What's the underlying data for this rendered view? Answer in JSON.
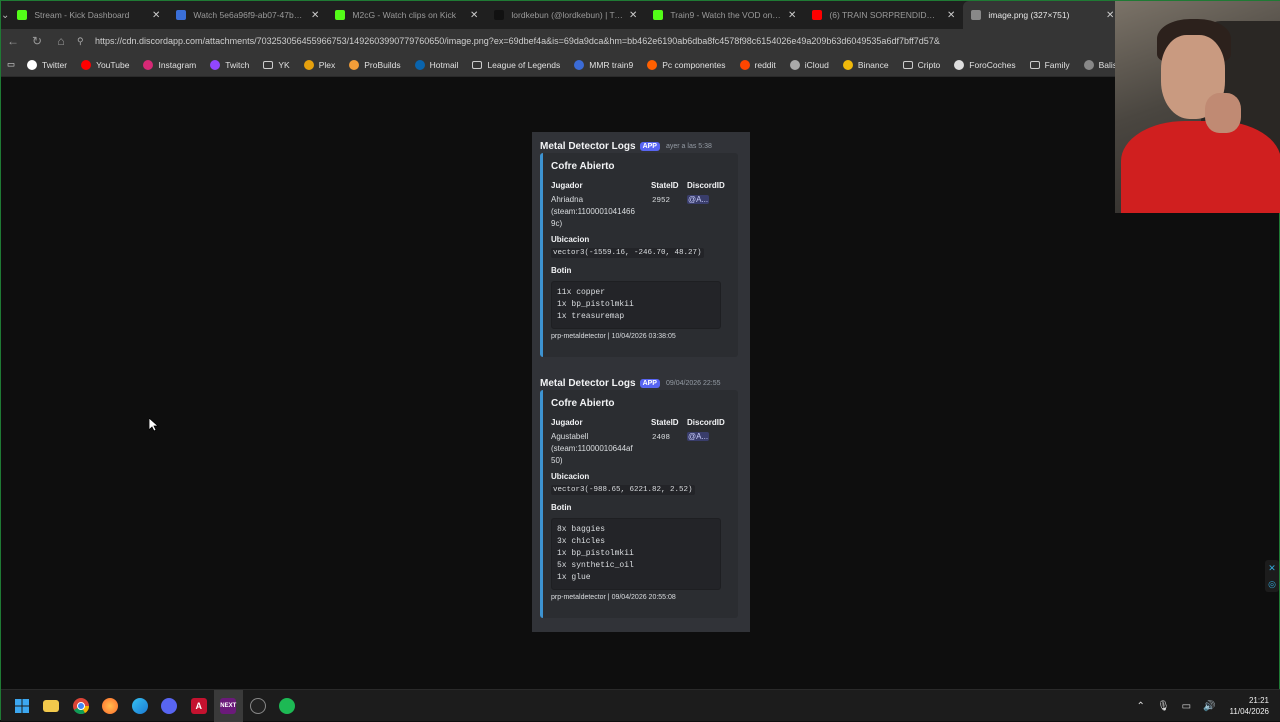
{
  "browser": {
    "tabs": [
      {
        "label": "Stream - Kick Dashboard",
        "icon": "kick-icon",
        "color": "#53fc18",
        "active": false
      },
      {
        "label": "Watch 5e6a96f9-ab07-47b6-84a7",
        "icon": "globe-icon",
        "color": "#3a6fd8",
        "active": false
      },
      {
        "label": "M2cG - Watch clips on Kick",
        "icon": "kick-icon",
        "color": "#53fc18",
        "active": false
      },
      {
        "label": "lordkebun (@lordkebun) | TikTok",
        "icon": "tiktok-icon",
        "color": "#111111",
        "active": false
      },
      {
        "label": "Train9 - Watch the VOD on Kick",
        "icon": "kick-icon",
        "color": "#53fc18",
        "active": false
      },
      {
        "label": "(6) TRAIN SORPRENDIDO por AR",
        "icon": "youtube-icon",
        "color": "#ff0000",
        "active": false
      },
      {
        "label": "image.png (327×751)",
        "icon": "globe-icon",
        "color": "#888888",
        "active": true
      }
    ],
    "url": "https://cdn.discordapp.com/attachments/703253056455966753/1492603990779760650/image.png?ex=69dbef4a&is=69da9dca&hm=bb462e6190ab6dba8fc4578f98c6154026e49a209b63d6049535a6df7bff7d57&",
    "bookmarks": [
      {
        "label": "Twitter",
        "icon": "x-icon"
      },
      {
        "label": "YouTube",
        "icon": "youtube-icon"
      },
      {
        "label": "Instagram",
        "icon": "instagram-icon"
      },
      {
        "label": "Twitch",
        "icon": "twitch-icon"
      },
      {
        "label": "YK",
        "icon": "folder-icon"
      },
      {
        "label": "Plex",
        "icon": "plex-icon"
      },
      {
        "label": "ProBuilds",
        "icon": "probuilds-icon"
      },
      {
        "label": "Hotmail",
        "icon": "outlook-icon"
      },
      {
        "label": "League of Legends",
        "icon": "folder-icon"
      },
      {
        "label": "MMR train9",
        "icon": "mmr-icon"
      },
      {
        "label": "Pc componentes",
        "icon": "pccomponentes-icon"
      },
      {
        "label": "reddit",
        "icon": "reddit-icon"
      },
      {
        "label": "iCloud",
        "icon": "apple-icon"
      },
      {
        "label": "Binance",
        "icon": "binance-icon"
      },
      {
        "label": "Cripto",
        "icon": "folder-icon"
      },
      {
        "label": "ForoCoches",
        "icon": "forocoches-icon"
      },
      {
        "label": "Family",
        "icon": "folder-icon"
      },
      {
        "label": "Balistics -",
        "icon": "balistics-icon"
      }
    ]
  },
  "messages": [
    {
      "author": "Metal Detector Logs",
      "badge": "APP",
      "time": "ayer a las 5:38",
      "title": "Cofre Abierto",
      "f1_name": "Jugador",
      "f1_lines": [
        "Ahriadna",
        "(steam:1100001041466",
        "9c)"
      ],
      "f2_name": "StateID",
      "f2_val": "2952",
      "f3_name": "DiscordID",
      "f3_val": "@A...",
      "loc_name": "Ubicacion",
      "loc_val": "vector3(-1559.16, -246.70, 48.27)",
      "loot_name": "Botin",
      "loot": [
        "11x copper",
        "1x bp_pistolmkii",
        "1x treasuremap"
      ],
      "footer": "prp-metaldetector | 10/04/2026 03:38:05"
    },
    {
      "author": "Metal Detector Logs",
      "badge": "APP",
      "time": "09/04/2026 22:55",
      "title": "Cofre Abierto",
      "f1_name": "Jugador",
      "f1_lines": [
        "Agustabell",
        "(steam:11000010644af",
        "50)"
      ],
      "f2_name": "StateID",
      "f2_val": "2408",
      "f3_name": "DiscordID",
      "f3_val": "@A...",
      "loc_name": "Ubicacion",
      "loc_val": "vector3(-988.65, 6221.82, 2.52)",
      "loot_name": "Botin",
      "loot": [
        "8x baggies",
        "3x chicles",
        "1x bp_pistolmkii",
        "5x synthetic_oil",
        "1x glue"
      ],
      "footer": "prp-metaldetector | 09/04/2026 20:55:08"
    }
  ],
  "taskbar": {
    "apps": [
      "windows-start-icon",
      "file-explorer-icon",
      "chrome-icon",
      "firefox-icon",
      "edge-icon",
      "discord-icon",
      "adobe-icon",
      "kick-app-icon",
      "obs-icon",
      "spotify-icon"
    ],
    "time": "21:21",
    "date": "11/04/2026"
  },
  "colors": {
    "embed_border": "#3d93d1",
    "app_badge": "#5865f2",
    "discord_bg": "#313338"
  }
}
